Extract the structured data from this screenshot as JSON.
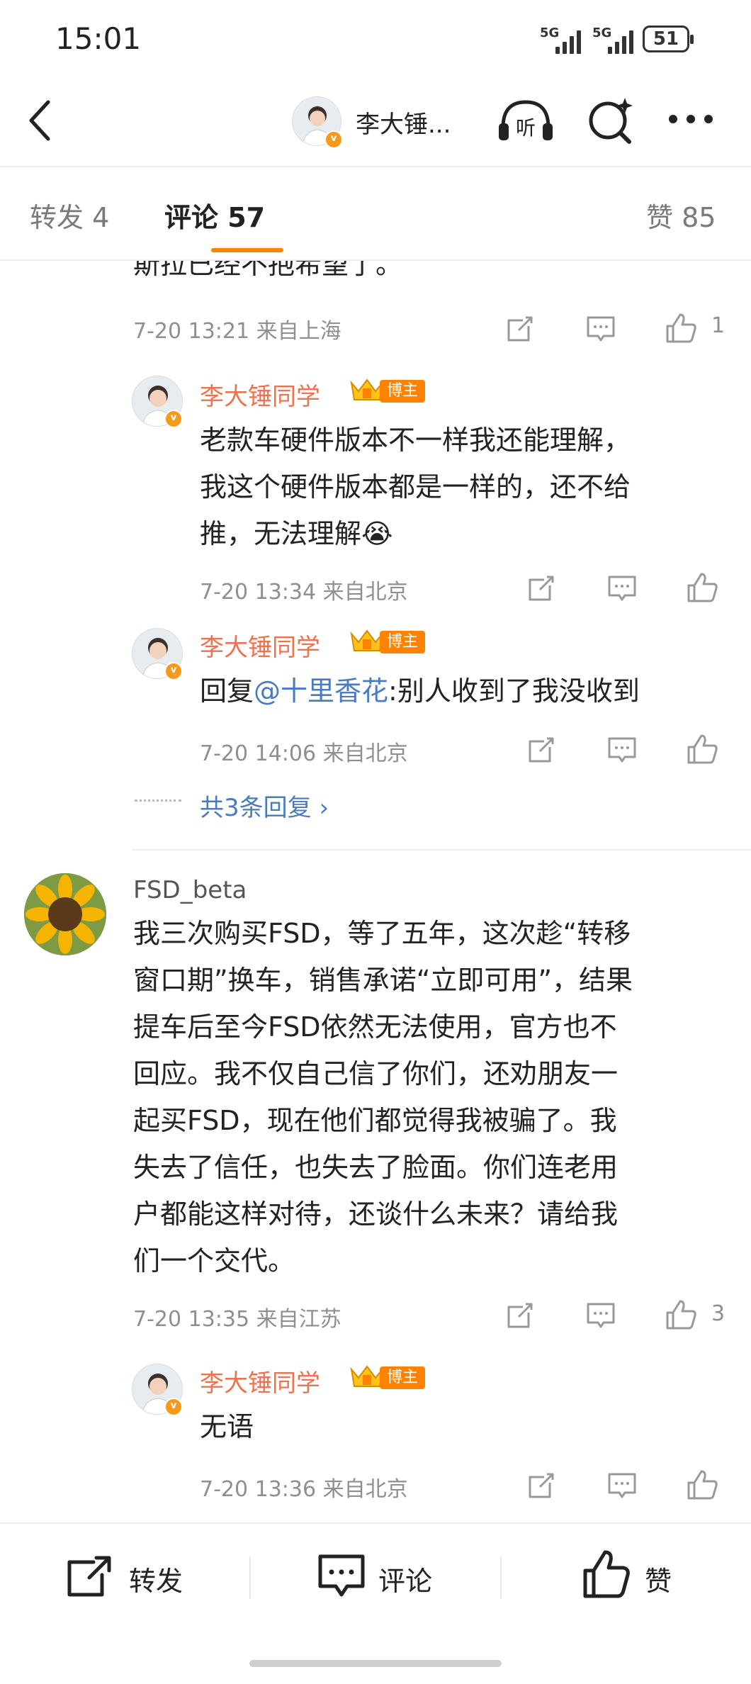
{
  "status_bar": {
    "time": "15:01",
    "signal_1": "5G",
    "signal_2": "5G",
    "battery": "51"
  },
  "nav": {
    "title": "李大锤...",
    "listen_label": "听"
  },
  "tabs": {
    "repost": "转发 4",
    "comments": "评论 57",
    "likes": "赞 85"
  },
  "thread1": {
    "text_tail": "斯拉已经不抱希望了。",
    "meta": "7-20 13:21  来自上海",
    "like_count": "1",
    "reply1": {
      "name": "李大锤同学",
      "tag": "博主",
      "lines": [
        "老款车硬件版本不一样我还能理解，",
        "我这个硬件版本都是一样的，还不给",
        "推，无法理解😭"
      ],
      "meta": "7-20 13:34  来自北京"
    },
    "reply2": {
      "name": "李大锤同学",
      "tag": "博主",
      "prefix": "回复",
      "mention": "@十里香花",
      "suffix": ":别人收到了我没收到",
      "meta": "7-20 14:06  来自北京"
    },
    "more_replies": "共3条回复 ›"
  },
  "thread2": {
    "name": "FSD_beta",
    "lines": [
      "我三次购买FSD，等了五年，这次趁“转移",
      "窗口期”换车，销售承诺“立即可用”，结果",
      "提车后至今FSD依然无法使用，官方也不",
      "回应。我不仅自己信了你们，还劝朋友一",
      "起买FSD，现在他们都觉得我被骗了。我",
      "失去了信任，也失去了脸面。你们连老用",
      "户都能这样对待，还谈什么未来？请给我",
      "们一个交代。"
    ],
    "meta": "7-20 13:35  来自江苏",
    "like_count": "3",
    "reply1": {
      "name": "李大锤同学",
      "tag": "博主",
      "text": "无语",
      "meta": "7-20 13:36  来自北京"
    }
  },
  "bottom_bar": {
    "repost": "转发",
    "comment": "评论",
    "like": "赞"
  },
  "colors": {
    "accent": "#ff8200",
    "name": "#eb7350",
    "link": "#4a7bbf",
    "meta": "#8f8f8f"
  }
}
